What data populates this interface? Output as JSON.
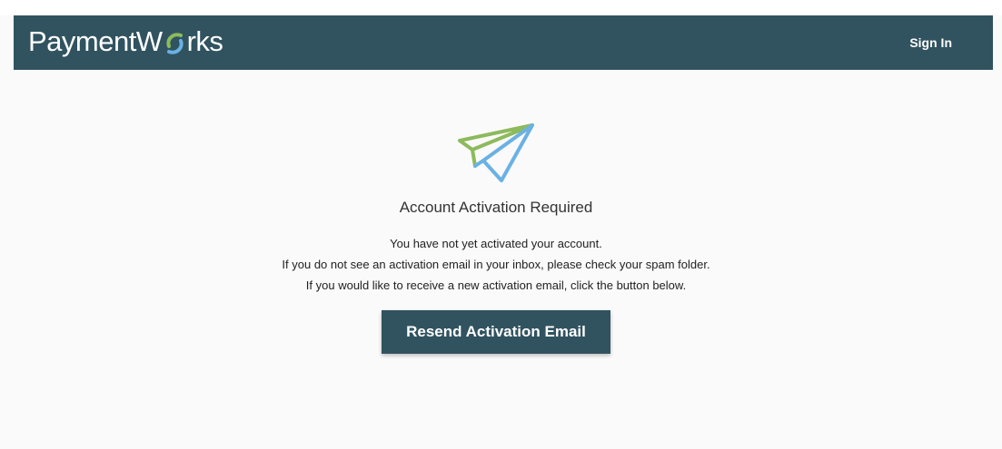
{
  "header": {
    "brand_left": "PaymentW",
    "brand_right": "rks",
    "signin_label": "Sign In",
    "bar_color": "#30535f"
  },
  "main": {
    "icon": "paper-plane-icon",
    "heading": "Account Activation Required",
    "messages": [
      "You have not yet activated your account.",
      "If you do not see an activation email in your inbox, please check your spam folder.",
      "If you would like to receive a new activation email, click the button below."
    ],
    "resend_label": "Resend Activation Email"
  },
  "colors": {
    "accent_green": "#8dba5c",
    "accent_blue": "#6ab1e4",
    "button_bg": "#30535f"
  }
}
